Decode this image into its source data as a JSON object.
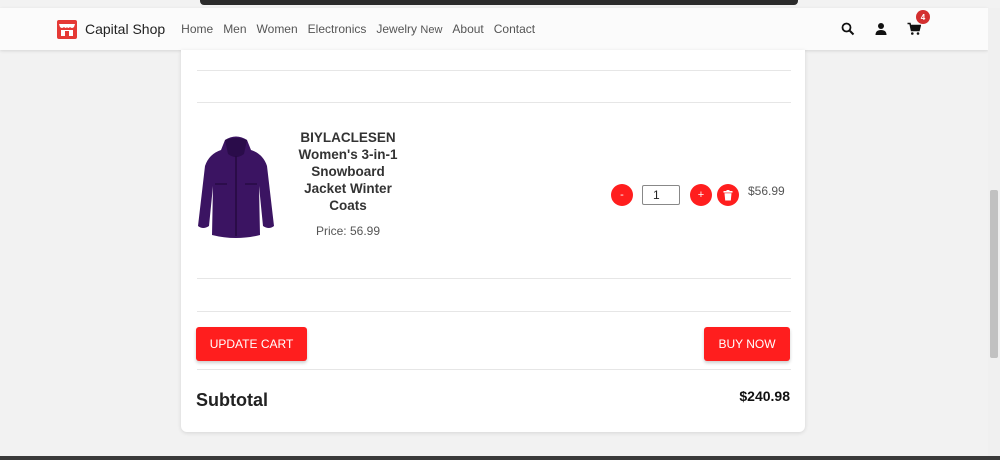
{
  "brand": {
    "name": "Capital Shop"
  },
  "nav": {
    "links": [
      "Home",
      "Men",
      "Women",
      "Electronics",
      "Jewelry",
      "About",
      "Contact"
    ],
    "new_badge": "New"
  },
  "cart": {
    "count": "4"
  },
  "product": {
    "title": "BIYLACLESEN Women's 3-in-1 Snowboard Jacket Winter Coats",
    "price": "Price: 56.99",
    "quantity": "1",
    "line_total": "$56.99",
    "decrease_label": "-",
    "increase_label": "+"
  },
  "actions": {
    "update_cart": "UPDATE CART",
    "buy_now": "BUY NOW"
  },
  "subtotal": {
    "label": "Subtotal",
    "value": "$240.98"
  },
  "colors": {
    "accent": "#ff1e1e",
    "badge": "#d32f2f",
    "jacket": "#3b1462"
  },
  "icons": [
    "store-logo-icon",
    "search-icon",
    "user-icon",
    "cart-icon",
    "trash-icon"
  ]
}
